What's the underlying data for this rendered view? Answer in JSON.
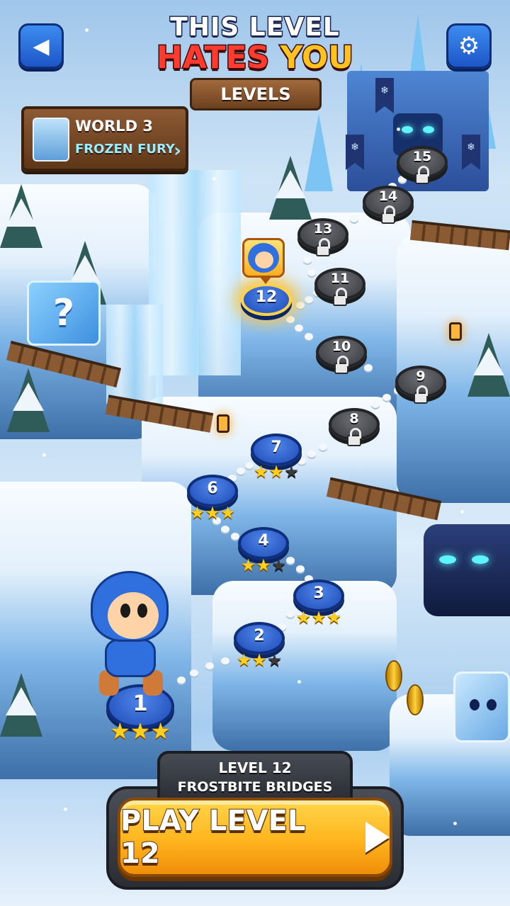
{
  "header": {
    "title_line1": "THIS LEVEL",
    "title_line2_a": "HATES ",
    "title_line2_b": "YOU",
    "subtitle": "LEVELS",
    "back_icon": "back-arrow-icon",
    "settings_icon": "gear-icon"
  },
  "world": {
    "name": "WORLD 3",
    "subtitle": "FROZEN FURY",
    "chevron": "›"
  },
  "mystery_box": {
    "glyph": "?"
  },
  "levels": [
    {
      "num": "1",
      "stars": 3,
      "locked": false
    },
    {
      "num": "2",
      "stars": 2,
      "locked": false
    },
    {
      "num": "3",
      "stars": 3,
      "locked": false
    },
    {
      "num": "4",
      "stars": 2,
      "locked": false
    },
    {
      "num": "6",
      "stars": 3,
      "locked": false
    },
    {
      "num": "7",
      "stars": 2,
      "locked": false
    },
    {
      "num": "12",
      "stars": 0,
      "locked": false,
      "current": true
    },
    {
      "num": "8",
      "locked": true
    },
    {
      "num": "9",
      "locked": true
    },
    {
      "num": "10",
      "locked": true
    },
    {
      "num": "11",
      "locked": true
    },
    {
      "num": "13",
      "locked": true
    },
    {
      "num": "14",
      "locked": true
    },
    {
      "num": "15",
      "locked": true
    }
  ],
  "panel": {
    "level_label": "LEVEL 12",
    "level_name": "FROSTBITE BRIDGES",
    "play_label": "PLAY LEVEL 12",
    "play_icon": "play-triangle-icon"
  },
  "colors": {
    "accent_blue": "#1d56c8",
    "play_orange": "#ffb41e",
    "locked_gray": "#38393d",
    "star_gold": "#ffcf1f"
  }
}
